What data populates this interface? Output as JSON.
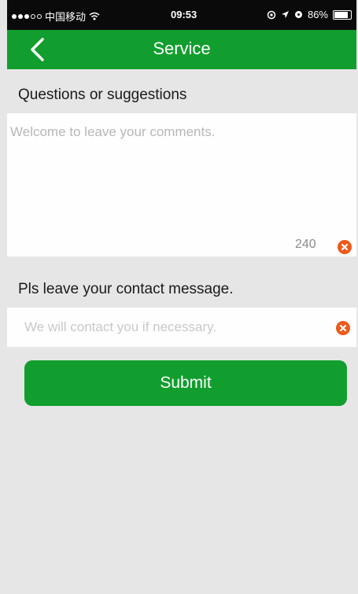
{
  "status_bar": {
    "carrier": "中国移动",
    "time": "09:53",
    "battery": "86%",
    "battery_level": 0.86
  },
  "header": {
    "title": "Service"
  },
  "feedback": {
    "label": "Questions or suggestions",
    "placeholder": "Welcome to leave your comments.",
    "remaining": "240"
  },
  "contact": {
    "label": "Pls leave your contact message.",
    "placeholder": "We will contact you if necessary."
  },
  "submit_label": "Submit",
  "colors": {
    "brand_green": "#119e2e",
    "clear_orange": "#ee5a1b",
    "background": "#e6e6e6"
  }
}
